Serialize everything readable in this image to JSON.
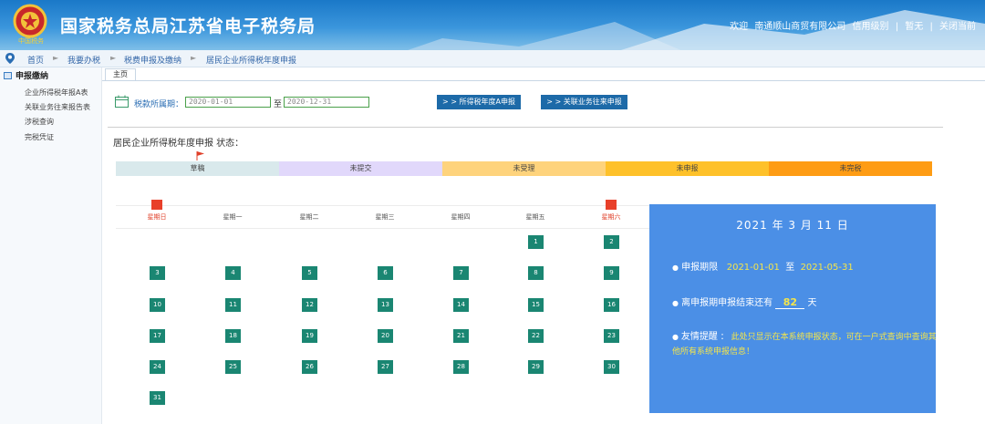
{
  "header": {
    "title": "国家税务总局江苏省电子税务局",
    "emblem_text": "中国税务",
    "user_bar": {
      "welcome": "欢迎",
      "company": "南通顺山商贸有限公司",
      "credit_label": "信用级别",
      "sep": "|",
      "credit_value": "暂无",
      "close_label": "关闭当前"
    }
  },
  "breadcrumb": [
    "首页",
    "我要办税",
    "税费申报及缴纳",
    "居民企业所得税年度申报"
  ],
  "breadcrumb_sep": "►",
  "sidebar": {
    "heading": "申报缴纳",
    "items": [
      "企业所得税年报A表",
      "关联业务往来报告表",
      "涉税查询",
      "完税凭证"
    ]
  },
  "tab": {
    "label": "主页"
  },
  "period": {
    "label": "税款所属期：",
    "start": "2020-01-01",
    "to": "至",
    "end": "2020-12-31"
  },
  "buttons": {
    "annual_a": "> > 所得税年度A申报",
    "related": "> > 关联业务往来申报"
  },
  "status_title": "居民企业所得税年度申报 状态：",
  "legend": [
    {
      "label": "草稿",
      "color": "#d9e9ec"
    },
    {
      "label": "未提交",
      "color": "#e1d8fb"
    },
    {
      "label": "未受理",
      "color": "#fed37c"
    },
    {
      "label": "未申报",
      "color": "#fec12a"
    },
    {
      "label": "未完税",
      "color": "#fe9c14"
    }
  ],
  "weekdays": [
    "星期日",
    "星期一",
    "星期二",
    "星期三",
    "星期四",
    "星期五",
    "星期六"
  ],
  "calendar": {
    "rows": [
      [
        "",
        "",
        "",
        "",
        "",
        "1",
        "2"
      ],
      [
        "3",
        "4",
        "5",
        "6",
        "7",
        "8",
        "9"
      ],
      [
        "10",
        "11",
        "12",
        "13",
        "14",
        "15",
        "16"
      ],
      [
        "17",
        "18",
        "19",
        "20",
        "21",
        "22",
        "23"
      ],
      [
        "24",
        "25",
        "26",
        "27",
        "28",
        "29",
        "30"
      ],
      [
        "31",
        "",
        "",
        "",
        "",
        "",
        ""
      ]
    ]
  },
  "info": {
    "date": "2021 年 3 月 11 日",
    "bullet": "●",
    "period_label": "申报期限",
    "period_start": "2021-01-01",
    "period_to": "至",
    "period_end": "2021-05-31",
    "remaining_label": "离申报期申报结束还有",
    "remaining_days": "82",
    "remaining_unit": "天",
    "tip_label": "友情提醒",
    "tip_colon": "：",
    "tip_text": "此处只显示在本系统申报状态，可在一户式查询中查询其他所有系统申报信息！"
  },
  "colors": {
    "header_blue": "#1a78c8",
    "calendar_green": "#1a8672",
    "panel_blue": "#4b8fe6",
    "button_blue": "#1d6aa8"
  }
}
